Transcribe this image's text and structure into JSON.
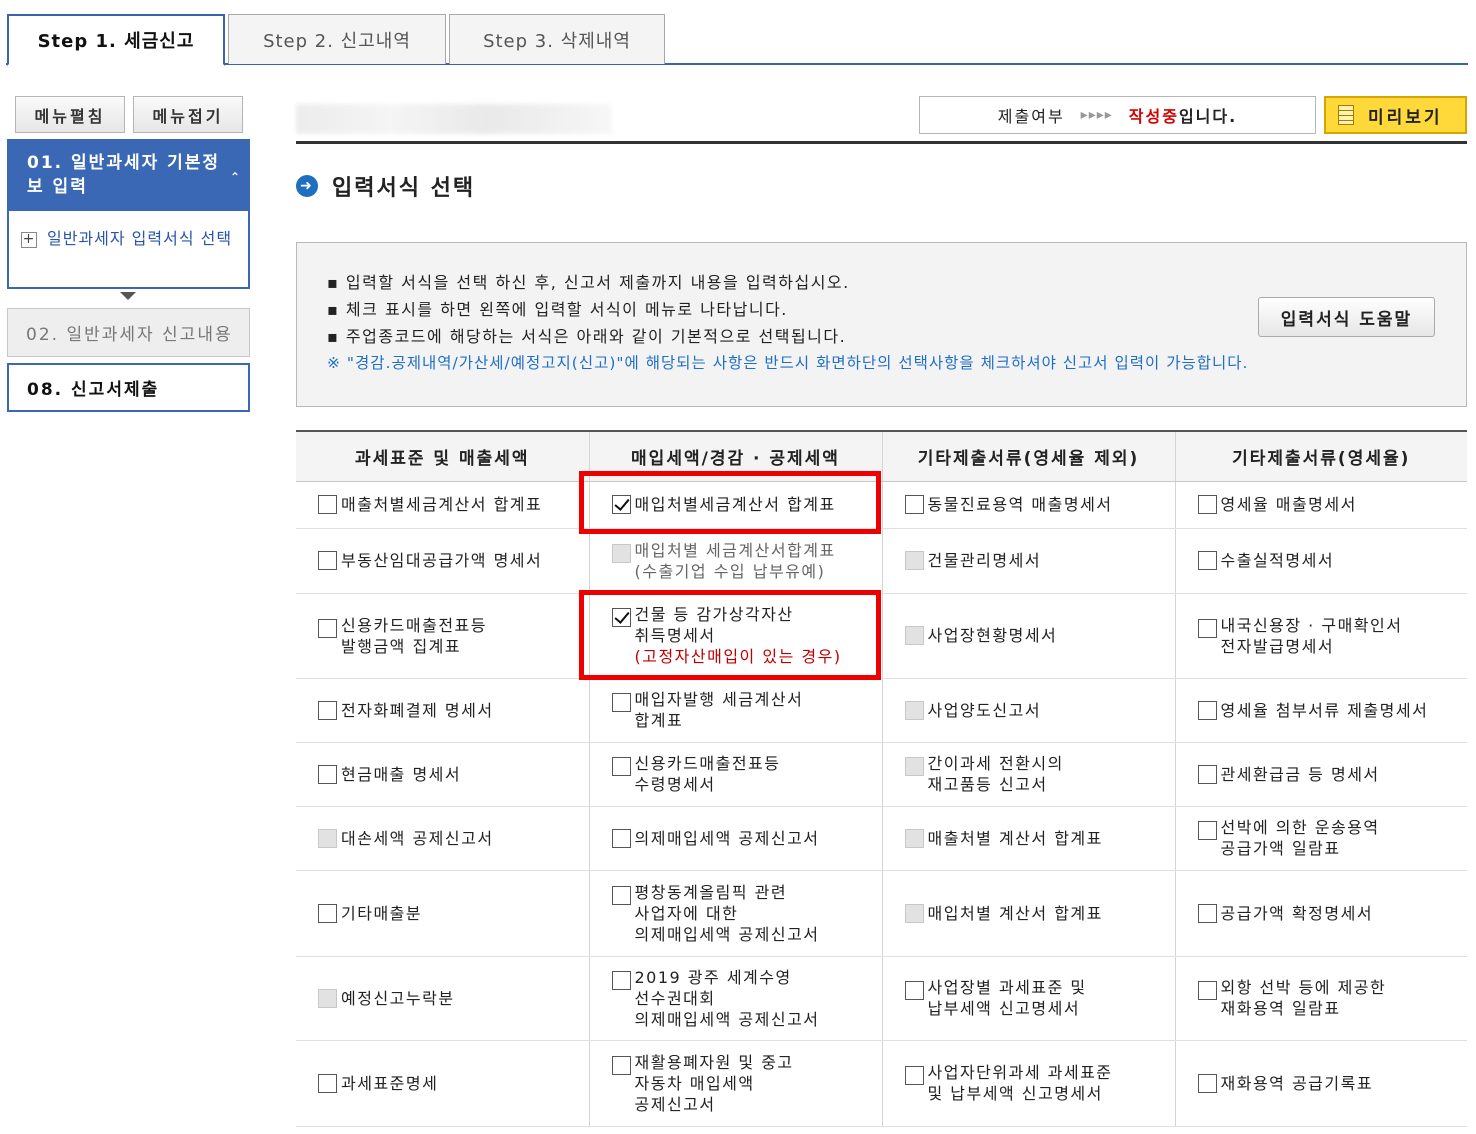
{
  "tabs": [
    {
      "label": "Step  1. 세금신고",
      "active": true
    },
    {
      "label": "Step  2. 신고내역",
      "active": false
    },
    {
      "label": "Step  3. 삭제내역",
      "active": false
    }
  ],
  "sidebar": {
    "expand_label": "메뉴펼침",
    "collapse_label": "메뉴접기",
    "step1": {
      "title": "01. 일반과세자 기본정보 입력",
      "caret": "⌃",
      "sub_item": "일반과세자 입력서식 선택"
    },
    "step2": "02. 일반과세자 신고내용",
    "step8": "08. 신고서제출"
  },
  "header": {
    "status_label": "제출여부",
    "status_arrows": "▸▸▸▸",
    "status_value": "작성중",
    "status_suffix": "입니다.",
    "preview_label": "미리보기"
  },
  "section": {
    "title": "입력서식 선택",
    "icon": "arrow-circle-icon"
  },
  "info": {
    "lines": [
      "▪ 입력할 서식을 선택 하신 후, 신고서 제출까지 내용을 입력하십시오.",
      "▪ 체크 표시를 하면 왼쪽에 입력할 서식이 메뉴로 나타납니다.",
      "▪ 주업종코드에 해당하는 서식은 아래와 같이 기본적으로 선택됩니다."
    ],
    "note": "※ \"경감.공제내역/가산세/예정고지(신고)\"에 해당되는 사항은 반드시 화면하단의 선택사항을 체크하셔야 신고서 입력이 가능합니다.",
    "help_button": "입력서식 도움말"
  },
  "table": {
    "headers": [
      "과세표준 및 매출세액",
      "매입세액/경감 · 공제세액",
      "기타제출서류(영세율 제외)",
      "기타제출서류(영세율)"
    ],
    "rows": [
      [
        {
          "label": "매출처별세금계산서 합계표",
          "state": "unchecked"
        },
        {
          "label": "매입처별세금계산서 합계표",
          "state": "checked"
        },
        {
          "label": "동물진료용역 매출명세서",
          "state": "unchecked"
        },
        {
          "label": "영세율 매출명세서",
          "state": "unchecked"
        }
      ],
      [
        {
          "label": "부동산임대공급가액 명세서",
          "state": "unchecked"
        },
        {
          "label": "매입처별 세금계산서합계표\n(수출기업 수입 납부유예)",
          "state": "disabled"
        },
        {
          "label": "건물관리명세서",
          "state": "disabled"
        },
        {
          "label": "수출실적명세서",
          "state": "unchecked"
        }
      ],
      [
        {
          "label": "신용카드매출전표등\n발행금액 집계표",
          "state": "unchecked"
        },
        {
          "label": "건물 등 감가상각자산\n취득명세서",
          "sub": "(고정자산매입이 있는 경우)",
          "state": "checked"
        },
        {
          "label": "사업장현황명세서",
          "state": "disabled"
        },
        {
          "label": "내국신용장 · 구매확인서\n전자발급명세서",
          "state": "unchecked"
        }
      ],
      [
        {
          "label": "전자화폐결제 명세서",
          "state": "unchecked"
        },
        {
          "label": "매입자발행 세금계산서\n합계표",
          "state": "unchecked"
        },
        {
          "label": "사업양도신고서",
          "state": "disabled"
        },
        {
          "label": "영세율 첨부서류 제출명세서",
          "state": "unchecked"
        }
      ],
      [
        {
          "label": "현금매출 명세서",
          "state": "unchecked"
        },
        {
          "label": "신용카드매출전표등\n수령명세서",
          "state": "unchecked"
        },
        {
          "label": "간이과세 전환시의\n재고품등 신고서",
          "state": "disabled"
        },
        {
          "label": "관세환급금 등 명세서",
          "state": "unchecked"
        }
      ],
      [
        {
          "label": "대손세액 공제신고서",
          "state": "disabled"
        },
        {
          "label": "의제매입세액 공제신고서",
          "state": "unchecked"
        },
        {
          "label": "매출처별 계산서 합계표",
          "state": "disabled"
        },
        {
          "label": "선박에 의한 운송용역\n공급가액 일람표",
          "state": "unchecked"
        }
      ],
      [
        {
          "label": "기타매출분",
          "state": "unchecked"
        },
        {
          "label": "평창동계올림픽 관련\n사업자에 대한\n의제매입세액 공제신고서",
          "state": "unchecked"
        },
        {
          "label": "매입처별 계산서 합계표",
          "state": "disabled"
        },
        {
          "label": "공급가액 확정명세서",
          "state": "unchecked"
        }
      ],
      [
        {
          "label": "예정신고누락분",
          "state": "disabled"
        },
        {
          "label": "2019 광주 세계수영\n선수권대회\n의제매입세액 공제신고서",
          "state": "unchecked"
        },
        {
          "label": "사업장별 과세표준 및\n납부세액 신고명세서",
          "state": "unchecked"
        },
        {
          "label": "외항 선박 등에 제공한\n재화용역 일람표",
          "state": "unchecked"
        }
      ],
      [
        {
          "label": "과세표준명세",
          "state": "unchecked"
        },
        {
          "label": "재활용폐자원 및 중고\n자동차 매입세액\n공제신고서",
          "state": "unchecked"
        },
        {
          "label": "사업자단위과세 과세표준\n및 납부세액 신고명세서",
          "state": "unchecked"
        },
        {
          "label": "재화용역 공급기록표",
          "state": "unchecked"
        }
      ]
    ]
  },
  "colors": {
    "accent": "#3a68b4",
    "highlight": "#ee0000",
    "status": "#d40000",
    "preview_bg": "#ffd83a"
  }
}
